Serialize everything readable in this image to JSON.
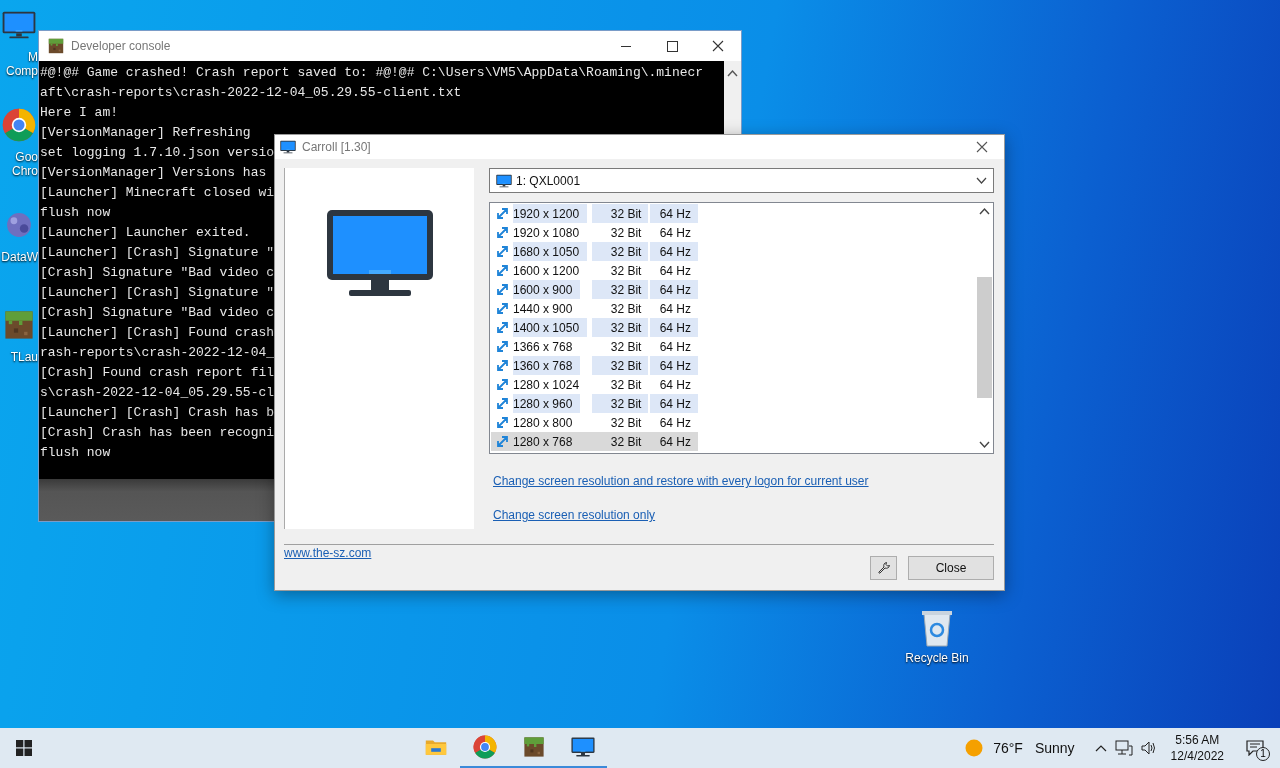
{
  "desktop_icons": [
    {
      "kind": "computer",
      "label_lines": [
        "M",
        "Comp"
      ]
    },
    {
      "kind": "chrome",
      "label_lines": [
        "Goo",
        "Chro"
      ]
    },
    {
      "kind": "network",
      "label_lines": [
        "DataW"
      ]
    },
    {
      "kind": "grass",
      "label_lines": [
        "TLau"
      ]
    }
  ],
  "console": {
    "title": "Developer console",
    "lines": [
      "#@!@# Game crashed! Crash report saved to: #@!@# C:\\Users\\VM5\\AppData\\Roaming\\.minecr",
      "aft\\crash-reports\\crash-2022-12-04_05.29.55-client.txt",
      "Here I am!",
      "[VersionManager] Refreshing",
      "set logging 1.7.10.json versio",
      "[VersionManager] Versions has",
      "[Launcher] Minecraft closed wi",
      "flush now",
      "[Launcher] Launcher exited.",
      "[Launcher] [Crash] Signature \"",
      "[Crash] Signature \"Bad video c",
      "[Launcher] [Crash] Signature \"",
      "[Crash] Signature \"Bad video c",
      "[Launcher] [Crash] Found crash",
      "rash-reports\\crash-2022-12-04_",
      "[Crash] Found crash report fil",
      "s\\crash-2022-12-04_05.29.55-cl",
      "[Launcher] [Crash] Crash has b",
      "[Crash] Crash has been recogni",
      "flush now"
    ]
  },
  "dialog": {
    "title": "Carroll [1.30]",
    "display": "1: QXL0001",
    "modes": [
      {
        "resolution": "1920 x 1200",
        "depth": "32 Bit",
        "rate": "64 Hz",
        "selected": false
      },
      {
        "resolution": "1920 x 1080",
        "depth": "32 Bit",
        "rate": "64 Hz",
        "selected": false
      },
      {
        "resolution": "1680 x 1050",
        "depth": "32 Bit",
        "rate": "64 Hz",
        "selected": false
      },
      {
        "resolution": "1600 x 1200",
        "depth": "32 Bit",
        "rate": "64 Hz",
        "selected": false
      },
      {
        "resolution": "1600 x 900",
        "depth": "32 Bit",
        "rate": "64 Hz",
        "selected": false
      },
      {
        "resolution": "1440 x 900",
        "depth": "32 Bit",
        "rate": "64 Hz",
        "selected": false
      },
      {
        "resolution": "1400 x 1050",
        "depth": "32 Bit",
        "rate": "64 Hz",
        "selected": false
      },
      {
        "resolution": "1366 x 768",
        "depth": "32 Bit",
        "rate": "64 Hz",
        "selected": false
      },
      {
        "resolution": "1360 x 768",
        "depth": "32 Bit",
        "rate": "64 Hz",
        "selected": false
      },
      {
        "resolution": "1280 x 1024",
        "depth": "32 Bit",
        "rate": "64 Hz",
        "selected": false
      },
      {
        "resolution": "1280 x 960",
        "depth": "32 Bit",
        "rate": "64 Hz",
        "selected": false
      },
      {
        "resolution": "1280 x 800",
        "depth": "32 Bit",
        "rate": "64 Hz",
        "selected": false
      },
      {
        "resolution": "1280 x 768",
        "depth": "32 Bit",
        "rate": "64 Hz",
        "selected": true
      }
    ],
    "links": [
      "Change screen resolution and restore with every logon for current user",
      "Change screen resolution only"
    ],
    "website": "www.the-sz.com",
    "close_button": "Close"
  },
  "recycle_bin": {
    "label": "Recycle Bin"
  },
  "taskbar": {
    "apps": [
      {
        "kind": "folder",
        "running": false
      },
      {
        "kind": "chrome",
        "running": true
      },
      {
        "kind": "grass",
        "running": true
      },
      {
        "kind": "monitor",
        "running": true
      }
    ],
    "weather": {
      "temperature": "76°F",
      "condition": "Sunny"
    },
    "time": "5:56 AM",
    "date": "12/4/2022",
    "notifications": "1"
  }
}
